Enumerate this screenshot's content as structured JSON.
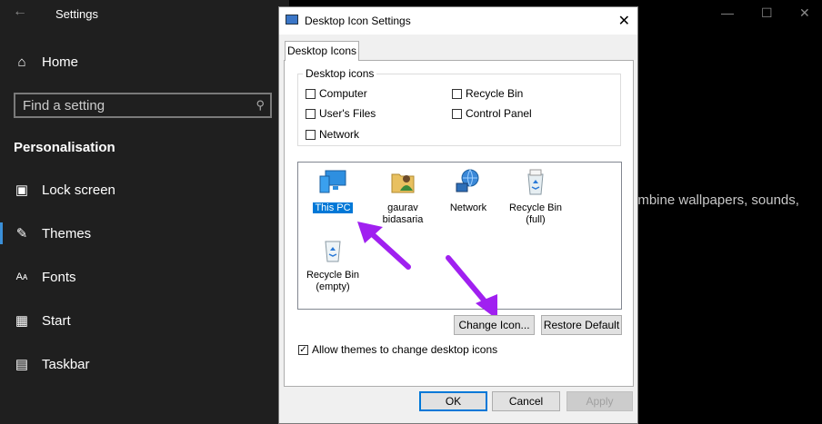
{
  "settings": {
    "title": "Settings",
    "home_label": "Home",
    "search_placeholder": "Find a setting",
    "section_title": "Personalisation",
    "nav_items": [
      {
        "label": "Lock screen",
        "icon": "monitor-icon"
      },
      {
        "label": "Themes",
        "icon": "brush-icon"
      },
      {
        "label": "Fonts",
        "icon": "fonts-icon"
      },
      {
        "label": "Start",
        "icon": "start-grid-icon"
      },
      {
        "label": "Taskbar",
        "icon": "taskbar-icon"
      }
    ],
    "background_text": "ombine wallpapers, sounds,",
    "accent": "#3a8fd8"
  },
  "dialog": {
    "title": "Desktop Icon Settings",
    "tab_label": "Desktop Icons",
    "group_label": "Desktop icons",
    "checkboxes": [
      {
        "label": "Computer",
        "checked": false
      },
      {
        "label": "User's Files",
        "checked": false
      },
      {
        "label": "Network",
        "checked": false
      },
      {
        "label": "Recycle Bin",
        "checked": false
      },
      {
        "label": "Control Panel",
        "checked": false
      }
    ],
    "icons": [
      {
        "label": "This PC",
        "icon": "this-pc-icon",
        "selected": true
      },
      {
        "label": "gaurav bidasaria",
        "icon": "user-folder-icon"
      },
      {
        "label": "Network",
        "icon": "network-globe-icon"
      },
      {
        "label": "Recycle Bin (full)",
        "icon": "recycle-bin-full-icon"
      },
      {
        "label": "Recycle Bin (empty)",
        "icon": "recycle-bin-empty-icon"
      }
    ],
    "change_icon_label": "Change Icon...",
    "restore_default_label": "Restore Default",
    "allow_themes_label": "Allow themes to change desktop icons",
    "allow_themes_checked": true,
    "ok_label": "OK",
    "cancel_label": "Cancel",
    "apply_label": "Apply"
  },
  "annotation_color": "#a020f0"
}
